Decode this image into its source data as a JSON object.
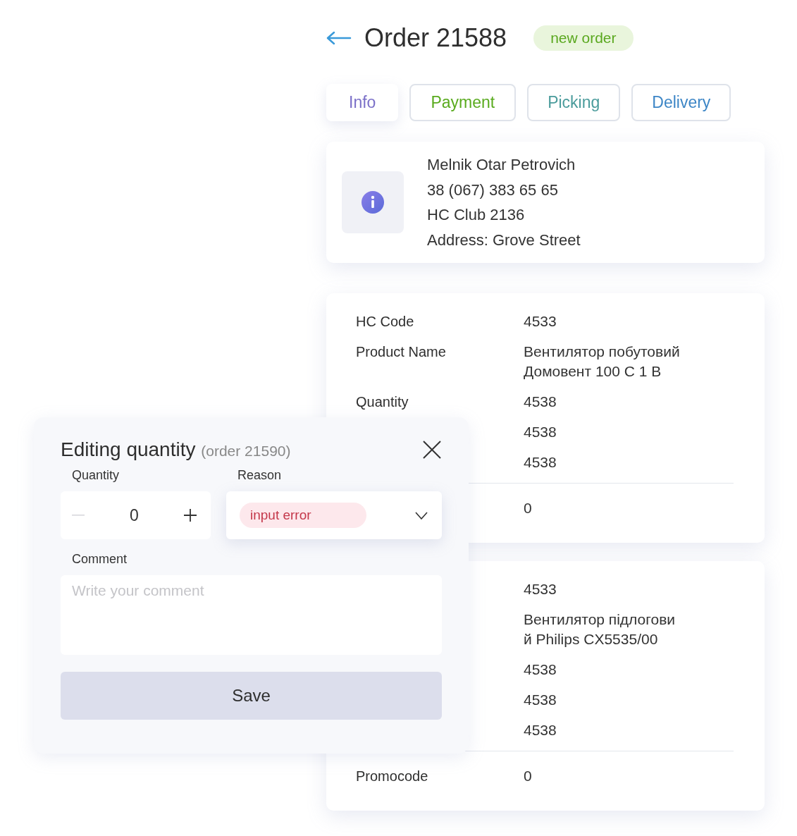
{
  "header": {
    "title": "Order 21588",
    "status": "new order"
  },
  "tabs": [
    {
      "label": "Info",
      "selected": true,
      "color": "#7b70c8"
    },
    {
      "label": "Payment",
      "selected": false,
      "color": "#5aab1f"
    },
    {
      "label": "Picking",
      "selected": false,
      "color": "#4b9c9c"
    },
    {
      "label": "Delivery",
      "selected": false,
      "color": "#3d86c6"
    }
  ],
  "customer": {
    "lines": [
      "Melnik Otar Petrovich",
      "38 (067) 383 65 65",
      "HC Club 2136",
      "Address: Grove Street"
    ]
  },
  "products": [
    {
      "rows": [
        {
          "kind": "field",
          "label": "HC Code",
          "value": "4533"
        },
        {
          "kind": "field",
          "label": "Product Name",
          "value": "Вентилятор побутовий Домовент 100 С 1 В"
        },
        {
          "kind": "field",
          "label": "Quantity",
          "value": "4538"
        },
        {
          "kind": "field",
          "value": "4538"
        },
        {
          "kind": "field",
          "value": "4538"
        },
        {
          "kind": "summary",
          "value": "0"
        }
      ]
    },
    {
      "rows": [
        {
          "kind": "field",
          "value": "4533"
        },
        {
          "kind": "field",
          "value": "Вентилятор підлогови й Philips CX5535/00"
        },
        {
          "kind": "field",
          "value": "4538"
        },
        {
          "kind": "field",
          "value": "4538"
        },
        {
          "kind": "field",
          "value": "4538"
        },
        {
          "kind": "summary",
          "label": "Promocode",
          "value": "0"
        }
      ]
    }
  ],
  "modal": {
    "title": "Editing quantity",
    "subtitle": "(order 21590)",
    "quantity_label": "Quantity",
    "quantity": "0",
    "decrement_disabled": true,
    "reason_label": "Reason",
    "reason": "input error",
    "comment_label": "Comment",
    "comment_placeholder": "Write your comment",
    "save": "Save"
  }
}
